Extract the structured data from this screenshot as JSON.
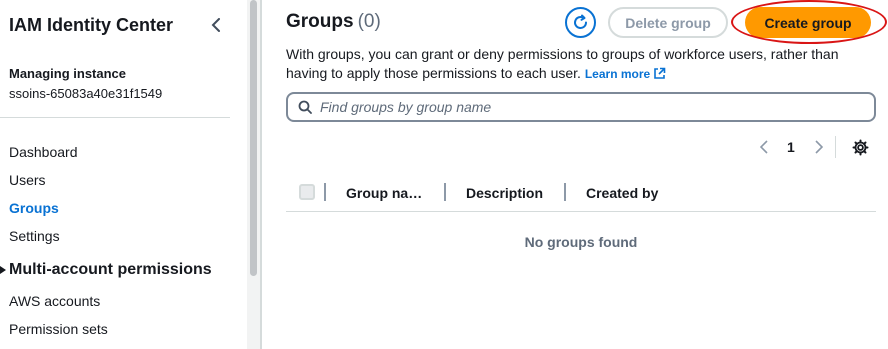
{
  "sidebar": {
    "title": "IAM Identity Center",
    "managing_label": "Managing instance",
    "managing_value": "ssoins-65083a40e31f1549",
    "items": [
      {
        "label": "Dashboard"
      },
      {
        "label": "Users"
      },
      {
        "label": "Groups"
      },
      {
        "label": "Settings"
      }
    ],
    "section_label": "Multi-account permissions",
    "section_items": [
      {
        "label": "AWS accounts"
      },
      {
        "label": "Permission sets"
      }
    ]
  },
  "header": {
    "title": "Groups",
    "count": "(0)",
    "delete_label": "Delete group",
    "create_label": "Create group",
    "description": "With groups, you can grant or deny permissions to groups of workforce users, rather than having to apply those permissions to each user.",
    "learn_more": "Learn more"
  },
  "search": {
    "placeholder": "Find groups by group name"
  },
  "pagination": {
    "current_page": "1"
  },
  "table": {
    "columns": [
      "Group na…",
      "Description",
      "Created by"
    ],
    "empty_text": "No groups found"
  },
  "colors": {
    "accent": "#0972d3",
    "primary_button": "#ff9900",
    "highlight_ring": "#d91515"
  }
}
